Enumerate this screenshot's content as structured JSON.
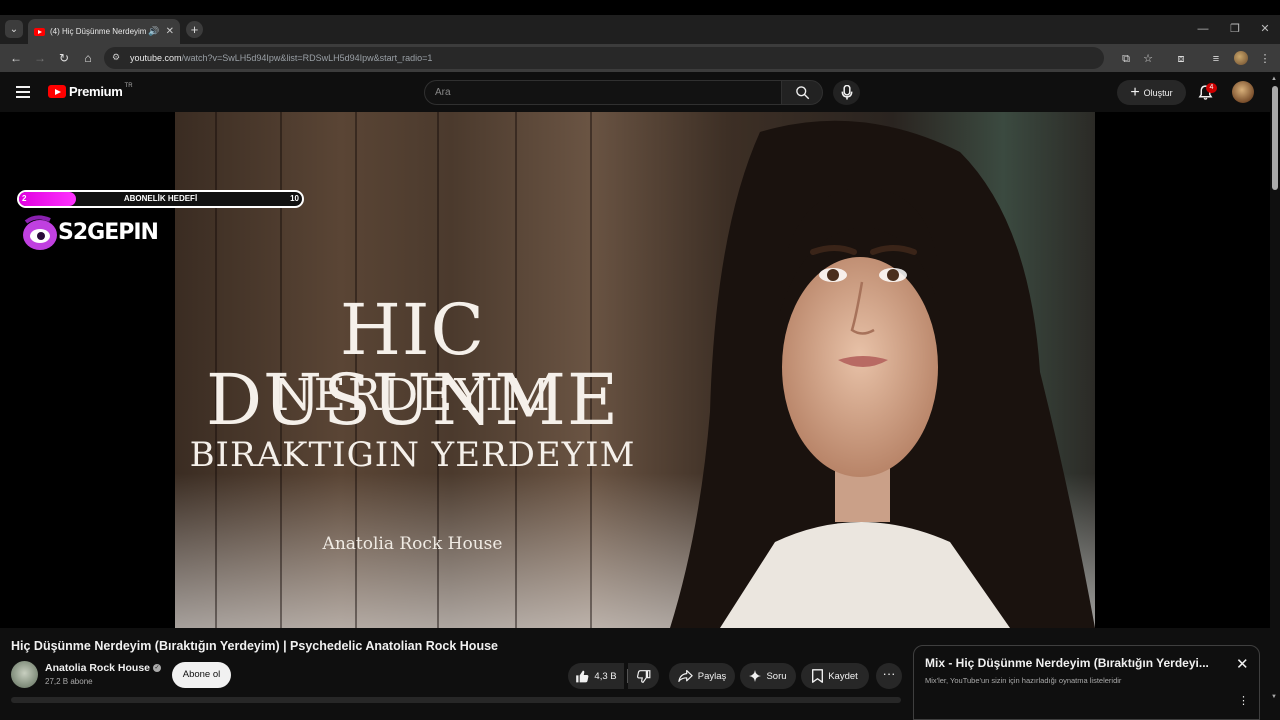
{
  "browser": {
    "tab_title": "(4) Hiç Düşünme Nerdeyim",
    "url_host": "youtube.com",
    "url_path": "/watch?v=SwLH5d94Ipw&list=RDSwLH5d94Ipw&start_radio=1"
  },
  "header": {
    "brand": "Premium",
    "country": "TR",
    "search_placeholder": "Ara",
    "create_label": "Oluştur",
    "notification_count": "4"
  },
  "video": {
    "thumb_title_line1": "HIC DUSUNME",
    "thumb_title_line2": "NERDEYIM",
    "thumb_title_line3": "BIRAKTIGIN YERDEYIM",
    "thumb_signature": "Anatolia Rock House"
  },
  "overlay": {
    "goal_start": "2",
    "goal_label": "ABONELİK HEDEFİ",
    "goal_end": "10",
    "goal_progress": 0.2,
    "logo_text": "S2GEPIN"
  },
  "details": {
    "title": "Hiç Düşünme Nerdeyim (Bıraktığın Yerdeyim) | Psychedelic Anatolian Rock House",
    "channel_name": "Anatolia Rock House",
    "subscribers": "27,2 B abone",
    "subscribe_label": "Abone ol",
    "likes": "4,3 B",
    "share_label": "Paylaş",
    "ask_label": "Soru",
    "save_label": "Kaydet"
  },
  "mix": {
    "title": "Mix - Hiç Düşünme Nerdeyim (Bıraktığın Yerdeyi...",
    "subtitle": "Mix'ler, YouTube'un sizin için hazırladığı oynatma listeleridir"
  },
  "colors": {
    "yt_red": "#ff0000",
    "goal_magenta": "#e000e0",
    "background": "#0f0f0f"
  }
}
